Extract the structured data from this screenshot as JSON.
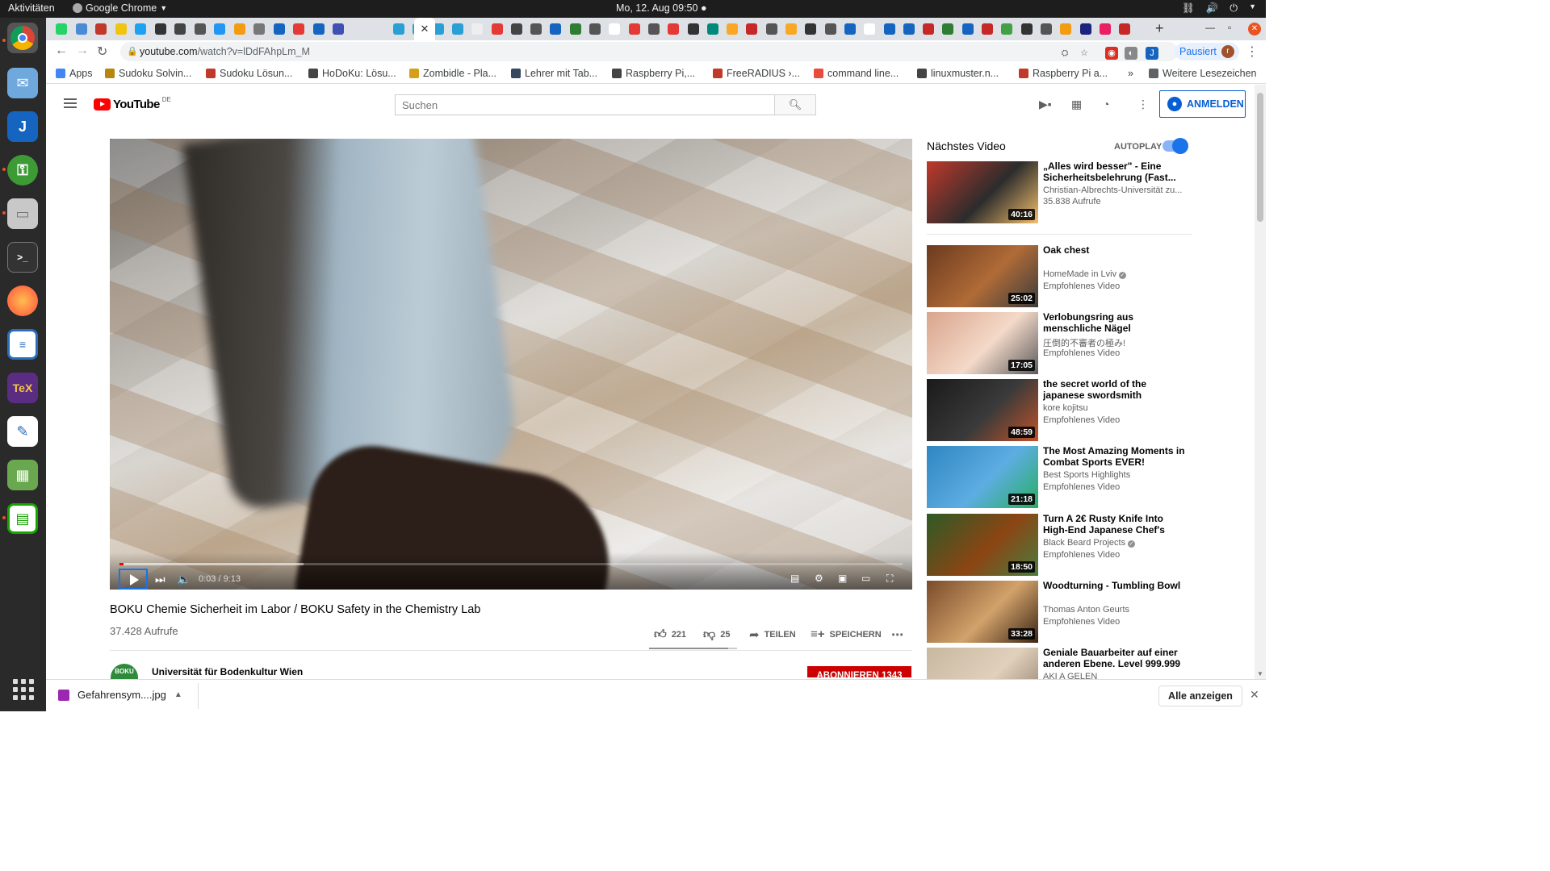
{
  "topbar": {
    "activities": "Aktivitäten",
    "app_name": "Google Chrome",
    "clock": "Mo, 12. Aug  09:50 ●"
  },
  "dock": {
    "apps": [
      "chrome",
      "mail",
      "joplin",
      "keepassxc",
      "files",
      "terminal",
      "firefox",
      "writer",
      "texmaker",
      "text-editor",
      "minetest",
      "calc"
    ]
  },
  "browser": {
    "url_host": "youtube.com",
    "url_path": "/watch?v=lDdFAhpLm_M",
    "profile_label": "Pausiert",
    "profile_initial": "r",
    "tab_close_glyph": "✕"
  },
  "bookmarks": [
    {
      "label": "Apps",
      "color": "#4285f4"
    },
    {
      "label": "Sudoku Solvin...",
      "color": "#b8860b"
    },
    {
      "label": "Sudoku Lösun...",
      "color": "#c0392b"
    },
    {
      "label": "HoDoKu: Lösu...",
      "color": "#444444"
    },
    {
      "label": "Zombidle - Pla...",
      "color": "#d4a017"
    },
    {
      "label": "Lehrer mit Tab...",
      "color": "#34495e"
    },
    {
      "label": "Raspberry Pi,...",
      "color": "#444444"
    },
    {
      "label": "FreeRADIUS ›...",
      "color": "#c0392b"
    },
    {
      "label": "command line...",
      "color": "#e74c3c"
    },
    {
      "label": "linuxmuster.n...",
      "color": "#444444"
    },
    {
      "label": "Raspberry Pi a...",
      "color": "#c0392b"
    }
  ],
  "bookmarks_more": "»",
  "bookmarks_other": "Weitere Lesezeichen",
  "yt": {
    "logo_word": "YouTube",
    "logo_region": "DE",
    "search_placeholder": "Suchen",
    "signin": "ANMELDEN"
  },
  "player": {
    "time": "0:03 / 9:13",
    "played_fraction": 0.005,
    "loaded_fraction": 0.235
  },
  "video": {
    "title": "BOKU Chemie Sicherheit im Labor / BOKU Safety in the Chemistry Lab",
    "views": "37.428 Aufrufe",
    "likes": "221",
    "dislikes": "25",
    "share": "TEILEN",
    "save": "SPEICHERN",
    "like_ratio": 0.898
  },
  "channel": {
    "name": "Universität für Bodenkultur Wien",
    "logo_text": "BOKU",
    "subscribe": "ABONNIEREN  1343"
  },
  "sidebar": {
    "next_label": "Nächstes Video",
    "autoplay_label": "AUTOPLAY",
    "autoplay_on": true,
    "items": [
      {
        "title": "„Alles wird besser\" - Eine Sicherheitsbelehrung (Fast...",
        "channel": "Christian-Albrechts-Universität zu...",
        "meta": "35.838 Aufrufe",
        "duration": "40:16",
        "verified": false,
        "thumb": [
          "#c0392b",
          "#2c2c2c",
          "#f5c16c"
        ]
      },
      {
        "title": "Oak chest",
        "channel": "HomeMade in Lviv",
        "meta": "Empfohlenes Video",
        "duration": "25:02",
        "verified": true,
        "thumb": [
          "#6b3a1e",
          "#b06b37",
          "#3c3c3c"
        ]
      },
      {
        "title": "Verlobungsring aus menschliche Nägel",
        "channel": "圧倒的不審者の極み!",
        "meta": "Empfohlenes Video",
        "duration": "17:05",
        "verified": false,
        "thumb": [
          "#d9a48c",
          "#f4d9c9",
          "#5b5b5b"
        ]
      },
      {
        "title": "the secret world of the japanese swordsmith",
        "channel": "kore kojitsu",
        "meta": "Empfohlenes Video",
        "duration": "48:59",
        "verified": false,
        "thumb": [
          "#1a1a1a",
          "#3a3a3a",
          "#c0542a"
        ]
      },
      {
        "title": "The Most Amazing Moments in Combat Sports EVER!",
        "channel": "Best Sports Highlights",
        "meta": "Empfohlenes Video",
        "duration": "21:18",
        "verified": false,
        "thumb": [
          "#2e86c1",
          "#5dade2",
          "#27ae60"
        ]
      },
      {
        "title": "Turn A 2€ Rusty Knife Into High-End Japanese Chef's Knife",
        "channel": "Black Beard Projects",
        "meta": "Empfohlenes Video",
        "duration": "18:50",
        "verified": true,
        "thumb": [
          "#2d5a27",
          "#8b4513",
          "#4a7c3f"
        ]
      },
      {
        "title": "Woodturning - Tumbling Bowl",
        "channel": "Thomas Anton Geurts",
        "meta": "Empfohlenes Video",
        "duration": "33:28",
        "verified": false,
        "thumb": [
          "#7a4b2a",
          "#d2a26b",
          "#3b2414"
        ]
      },
      {
        "title": "Geniale Bauarbeiter auf einer anderen Ebene. Level 999.999",
        "channel": "AKI A GELEN",
        "meta": "",
        "duration": "",
        "verified": false,
        "thumb": [
          "#c9b8a0",
          "#e0d0bc",
          "#8d7b68"
        ]
      }
    ]
  },
  "downloads": {
    "file": "Gefahrensym....jpg",
    "show_all": "Alle anzeigen"
  },
  "colors": {
    "yt_red": "#ff0000",
    "yt_blue": "#065fd4",
    "subscribe_red": "#cc0000"
  }
}
